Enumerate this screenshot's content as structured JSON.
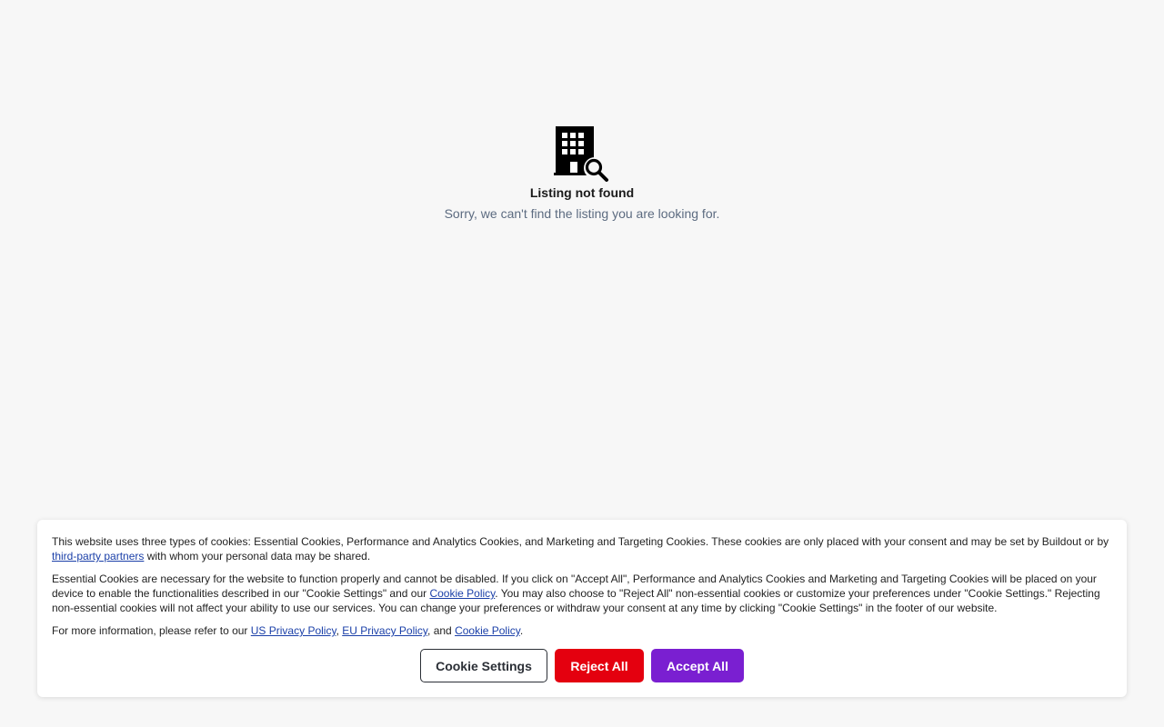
{
  "not_found": {
    "icon": "building-search-icon",
    "title": "Listing not found",
    "subtitle": "Sorry, we can't find the listing you are looking for."
  },
  "cookie_banner": {
    "p1_text1": "This website uses three types of cookies: Essential Cookies, Performance and Analytics Cookies, and Marketing and Targeting Cookies. These cookies are only placed with your consent and may be set by Buildout or by ",
    "p1_link": "third-party partners",
    "p1_text2": " with whom your personal data may be shared.",
    "p2_text1": "Essential Cookies are necessary for the website to function properly and cannot be disabled. If you click on \"Accept All\", Performance and Analytics Cookies and Marketing and Targeting Cookies will be placed on your device to enable the functionalities described in our \"Cookie Settings\" and our ",
    "p2_link": "Cookie Policy",
    "p2_text2": ". You may also choose to \"Reject All\" non-essential cookies or customize your preferences under \"Cookie Settings.\" Rejecting non-essential cookies will not affect your ability to use our services. You can change your preferences or withdraw your consent at any time by clicking \"Cookie Settings\" in the footer of our website.",
    "p3_text1": "For more information, please refer to our ",
    "p3_link1": "US Privacy Policy",
    "p3_sep1": ", ",
    "p3_link2": "EU Privacy Policy",
    "p3_sep2": ", and ",
    "p3_link3": "Cookie Policy",
    "p3_end": ".",
    "buttons": {
      "settings": "Cookie Settings",
      "reject": "Reject All",
      "accept": "Accept All"
    },
    "colors": {
      "reject": "#e4000f",
      "accept": "#7a1fd1",
      "link": "#1a3fa8"
    }
  }
}
